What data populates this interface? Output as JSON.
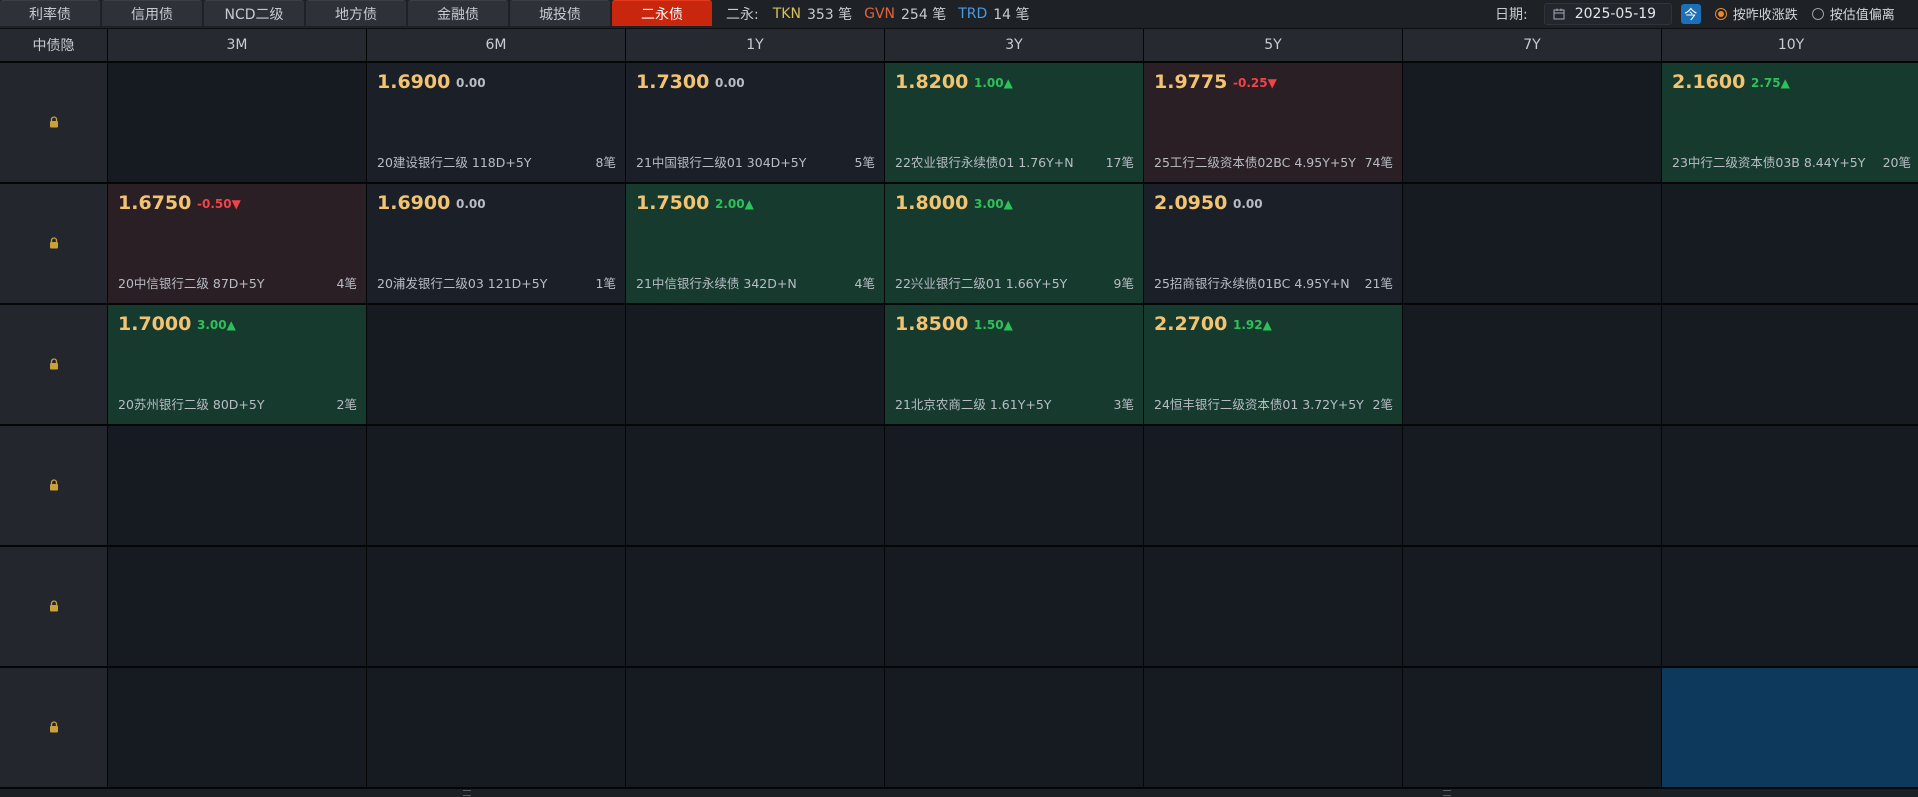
{
  "tabs": [
    {
      "label": "利率债",
      "active": false
    },
    {
      "label": "信用债",
      "active": false
    },
    {
      "label": "NCD二级",
      "active": false
    },
    {
      "label": "地方债",
      "active": false
    },
    {
      "label": "金融债",
      "active": false
    },
    {
      "label": "城投债",
      "active": false
    },
    {
      "label": "二永债",
      "active": true
    }
  ],
  "stats": {
    "prefix": "二永:",
    "tkn_label": "TKN",
    "tkn_value": "353 笔",
    "gvn_label": "GVN",
    "gvn_value": "254 笔",
    "trd_label": "TRD",
    "trd_value": "14 笔"
  },
  "date": {
    "label": "日期:",
    "value": "2025-05-19",
    "today_label": "今"
  },
  "options": [
    {
      "label": "按昨收涨跌",
      "checked": true
    },
    {
      "label": "按估值偏离",
      "checked": false
    }
  ],
  "grid": {
    "corner_label": "中债隐",
    "columns": [
      "3M",
      "6M",
      "1Y",
      "3Y",
      "5Y",
      "7Y",
      "10Y"
    ],
    "rows": [
      [
        null,
        {
          "price": "1.6900",
          "change": "0.00",
          "dir": "flat",
          "name": "20建设银行二级 118D+5Y",
          "count": "8笔"
        },
        {
          "price": "1.7300",
          "change": "0.00",
          "dir": "flat",
          "name": "21中国银行二级01 304D+5Y",
          "count": "5笔"
        },
        {
          "price": "1.8200",
          "change": "1.00▲",
          "dir": "up",
          "name": "22农业银行永续债01 1.76Y+N",
          "count": "17笔"
        },
        {
          "price": "1.9775",
          "change": "-0.25▼",
          "dir": "dn",
          "name": "25工行二级资本债02BC 4.95Y+5Y",
          "count": "74笔"
        },
        null,
        {
          "price": "2.1600",
          "change": "2.75▲",
          "dir": "up",
          "name": "23中行二级资本债03B 8.44Y+5Y",
          "count": "20笔"
        }
      ],
      [
        {
          "price": "1.6750",
          "change": "-0.50▼",
          "dir": "dn",
          "name": "20中信银行二级 87D+5Y",
          "count": "4笔"
        },
        {
          "price": "1.6900",
          "change": "0.00",
          "dir": "flat",
          "name": "20浦发银行二级03 121D+5Y",
          "count": "1笔"
        },
        {
          "price": "1.7500",
          "change": "2.00▲",
          "dir": "up",
          "name": "21中信银行永续债 342D+N",
          "count": "4笔"
        },
        {
          "price": "1.8000",
          "change": "3.00▲",
          "dir": "up",
          "name": "22兴业银行二级01 1.66Y+5Y",
          "count": "9笔"
        },
        {
          "price": "2.0950",
          "change": "0.00",
          "dir": "flat",
          "name": "25招商银行永续债01BC 4.95Y+N",
          "count": "21笔"
        },
        null,
        null
      ],
      [
        {
          "price": "1.7000",
          "change": "3.00▲",
          "dir": "up",
          "name": "20苏州银行二级 80D+5Y",
          "count": "2笔"
        },
        null,
        null,
        {
          "price": "1.8500",
          "change": "1.50▲",
          "dir": "up",
          "name": "21北京农商二级 1.61Y+5Y",
          "count": "3笔"
        },
        {
          "price": "2.2700",
          "change": "1.92▲",
          "dir": "up",
          "name": "24恒丰银行二级资本债01 3.72Y+5Y",
          "count": "2笔"
        },
        null,
        null
      ],
      [
        null,
        null,
        null,
        null,
        null,
        null,
        null
      ],
      [
        null,
        null,
        null,
        null,
        null,
        null,
        null
      ],
      [
        null,
        null,
        null,
        null,
        null,
        null,
        "selected"
      ]
    ]
  },
  "colors": {
    "accent": "#c9260e",
    "price": "#f2c472",
    "up": "#2ec05a",
    "down": "#f0434a",
    "up_cell_bg": "#173a2e",
    "down_cell_bg": "#2a1f25",
    "selected_cell_bg": "#0d3a5c"
  },
  "icons": {
    "lock": "lock-icon",
    "calendar": "calendar-icon",
    "grip": "resize-grip-icon"
  }
}
